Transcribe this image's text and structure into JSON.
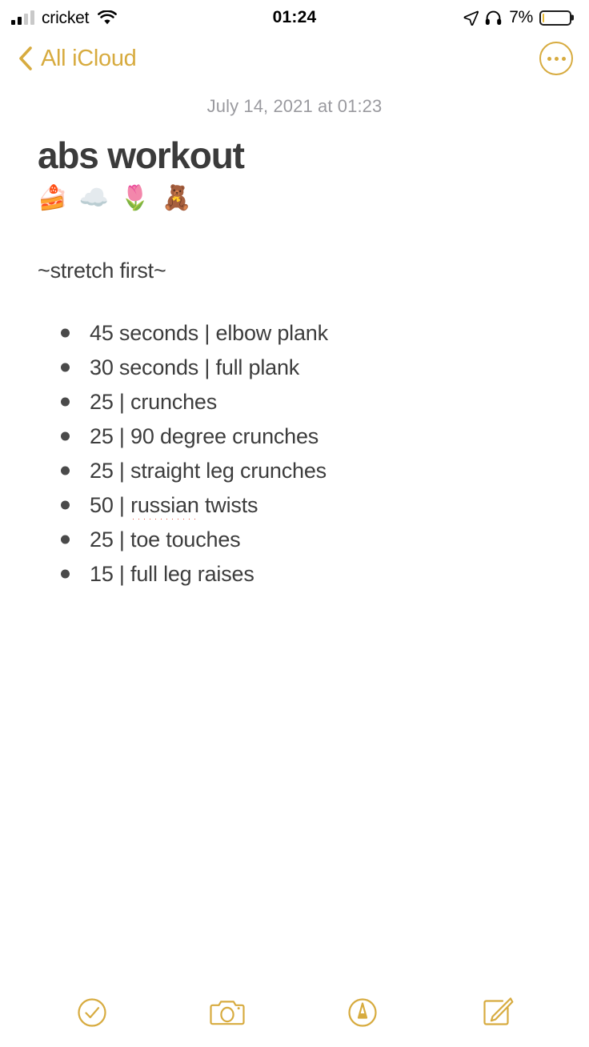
{
  "status_bar": {
    "carrier": "cricket",
    "time": "01:24",
    "battery_percent": "7%",
    "battery_level": 7,
    "battery_color": "#e8b931",
    "signal_bars_filled": 2,
    "signal_bars_total": 4,
    "icons": [
      "signal-bars-icon",
      "wifi-icon",
      "location-arrow-icon",
      "headphones-icon",
      "battery-icon"
    ]
  },
  "nav_bar": {
    "back_label": "All iCloud",
    "back_icon": "chevron-left-icon",
    "more_icon": "more-circle-icon",
    "accent_color": "#d7ab3f"
  },
  "note": {
    "date": "July 14, 2021 at 01:23",
    "title": "abs workout",
    "emoji_row": "🍰 ☁️ 🌷 🧸",
    "paragraph": "~stretch first~",
    "list": [
      {
        "text": "45 seconds | elbow plank",
        "misspelled": ""
      },
      {
        "text": "30 seconds | full plank",
        "misspelled": ""
      },
      {
        "text": "25 | crunches",
        "misspelled": ""
      },
      {
        "text": "25 | 90 degree crunches",
        "misspelled": ""
      },
      {
        "text": "25 | straight leg crunches",
        "misspelled": ""
      },
      {
        "text": "50 | ",
        "misspelled": "russian",
        "tail": " twists"
      },
      {
        "text": "25 | toe touches",
        "misspelled": ""
      },
      {
        "text": "15 | full leg raises",
        "misspelled": ""
      }
    ],
    "text_color": "#3d3d3d",
    "title_color": "#3b3b3b",
    "date_color": "#9a9a9f",
    "spellcheck_color": "#e0503c"
  },
  "toolbar": {
    "accent_color": "#d7ab3f",
    "buttons": [
      {
        "name": "checklist-button",
        "icon": "check-circle-icon"
      },
      {
        "name": "camera-button",
        "icon": "camera-icon"
      },
      {
        "name": "markup-button",
        "icon": "pen-circle-icon"
      },
      {
        "name": "compose-button",
        "icon": "compose-icon"
      }
    ]
  }
}
